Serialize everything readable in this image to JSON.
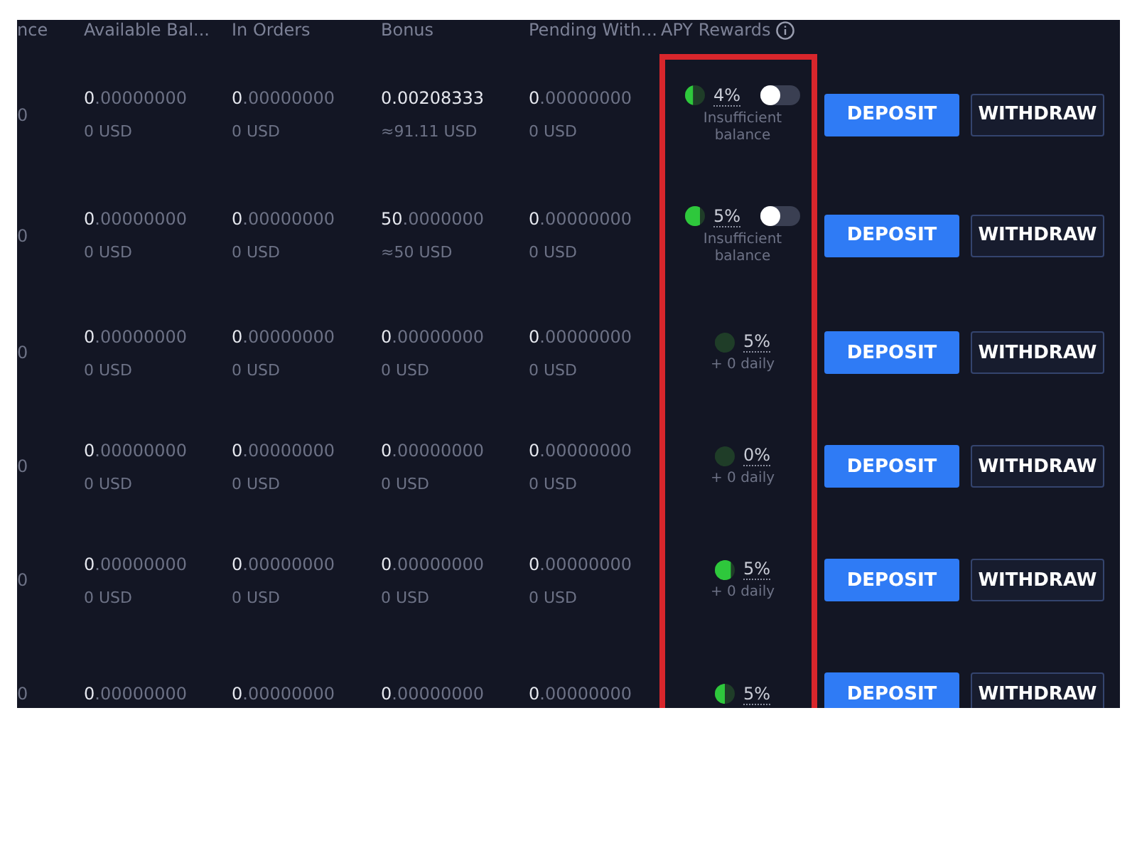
{
  "table": {
    "columns": [
      "nce",
      "Available Bal...",
      "In Orders",
      "Bonus",
      "Pending With...",
      "APY Rewards"
    ],
    "rows": [
      {
        "column_1": "0",
        "available": {
          "value": "**0**.00000000",
          "usd": "0 USD"
        },
        "in_orders": {
          "value": "**0**.00000000",
          "usd": "0 USD"
        },
        "bonus": {
          "value": "**0.00208333**",
          "usd": "≈91.11 USD"
        },
        "pending": {
          "value": "**0**.00000000",
          "usd": "0 USD"
        },
        "apy": {
          "level": 0.4,
          "rate": "4%",
          "kind": "toggle",
          "on": false,
          "note": "Insufficient balance"
        },
        "deposit": "DEPOSIT",
        "withdraw": "WITHDRAW"
      },
      {
        "column_1": "0",
        "available": {
          "value": "**0**.00000000",
          "usd": "0 USD"
        },
        "in_orders": {
          "value": "**0**.00000000",
          "usd": "0 USD"
        },
        "bonus": {
          "value": "**50**.0000000",
          "usd": "≈50 USD"
        },
        "pending": {
          "value": "**0**.00000000",
          "usd": "0 USD"
        },
        "apy": {
          "level": 0.75,
          "rate": "5%",
          "kind": "toggle",
          "on": false,
          "note": "Insufficient balance"
        },
        "deposit": "DEPOSIT",
        "withdraw": "WITHDRAW"
      },
      {
        "column_1": "0",
        "available": {
          "value": "**0**.00000000",
          "usd": "0 USD"
        },
        "in_orders": {
          "value": "**0**.00000000",
          "usd": "0 USD"
        },
        "bonus": {
          "value": "**0**.00000000",
          "usd": "0 USD"
        },
        "pending": {
          "value": "**0**.00000000",
          "usd": "0 USD"
        },
        "apy": {
          "level": 0,
          "rate": "5%",
          "kind": "daily",
          "note": "+ 0 daily"
        },
        "deposit": "DEPOSIT",
        "withdraw": "WITHDRAW"
      },
      {
        "column_1": "0",
        "available": {
          "value": "**0**.00000000",
          "usd": "0 USD"
        },
        "in_orders": {
          "value": "**0**.00000000",
          "usd": "0 USD"
        },
        "bonus": {
          "value": "**0**.00000000",
          "usd": "0 USD"
        },
        "pending": {
          "value": "**0**.00000000",
          "usd": "0 USD"
        },
        "apy": {
          "level": 0,
          "rate": "0%",
          "kind": "daily",
          "note": "+ 0 daily"
        },
        "deposit": "DEPOSIT",
        "withdraw": "WITHDRAW"
      },
      {
        "column_1": "0",
        "available": {
          "value": "**0**.00000000",
          "usd": "0 USD"
        },
        "in_orders": {
          "value": "**0**.00000000",
          "usd": "0 USD"
        },
        "bonus": {
          "value": "**0**.00000000",
          "usd": "0 USD"
        },
        "pending": {
          "value": "**0**.00000000",
          "usd": "0 USD"
        },
        "apy": {
          "level": 0.8,
          "rate": "5%",
          "kind": "daily",
          "note": "+ 0 daily"
        },
        "deposit": "DEPOSIT",
        "withdraw": "WITHDRAW"
      },
      {
        "column_1": "0",
        "available": {
          "value": "**0**.00000000"
        },
        "in_orders": {
          "value": "**0**.00000000"
        },
        "bonus": {
          "value": "**0**.00000000"
        },
        "pending": {
          "value": "**0**.00000000"
        },
        "apy": {
          "level": 0.5,
          "rate": "5%",
          "kind": "daily"
        },
        "deposit": "DEPOSIT",
        "withdraw": "WITHDRAW"
      }
    ]
  }
}
